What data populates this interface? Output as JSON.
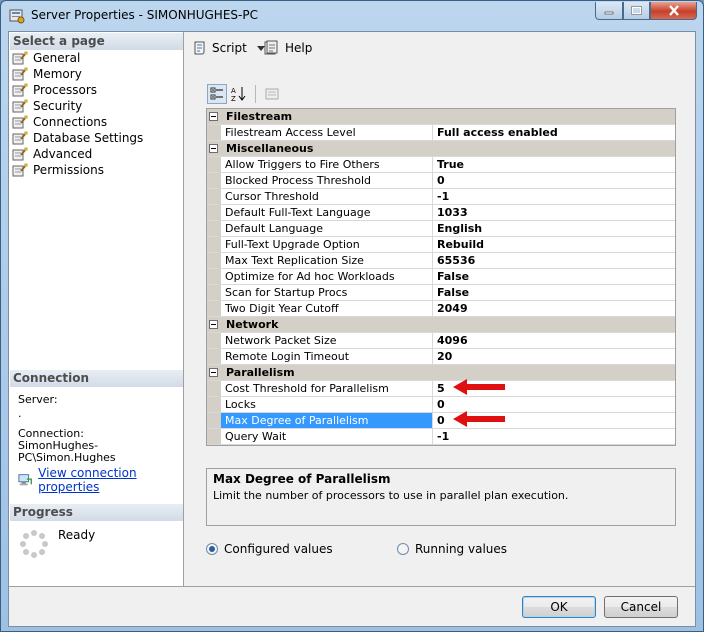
{
  "window": {
    "title": "Server Properties - SIMONHUGHES-PC"
  },
  "left_pane": {
    "select_page_header": "Select a page",
    "pages": [
      {
        "label": "General"
      },
      {
        "label": "Memory"
      },
      {
        "label": "Processors"
      },
      {
        "label": "Security"
      },
      {
        "label": "Connections"
      },
      {
        "label": "Database Settings"
      },
      {
        "label": "Advanced"
      },
      {
        "label": "Permissions"
      }
    ],
    "connection_header": "Connection",
    "server_label": "Server:",
    "server_value": ".",
    "connection_label": "Connection:",
    "connection_value": "SimonHughes-PC\\Simon.Hughes",
    "view_connection_link": "View connection properties",
    "progress_header": "Progress",
    "progress_status": "Ready"
  },
  "toolbar": {
    "script_label": "Script",
    "help_label": "Help"
  },
  "grid": {
    "rows": [
      {
        "type": "category",
        "label": "Filestream"
      },
      {
        "type": "prop",
        "name": "Filestream Access Level",
        "value": "Full access enabled"
      },
      {
        "type": "category",
        "label": "Miscellaneous"
      },
      {
        "type": "prop",
        "name": "Allow Triggers to Fire Others",
        "value": "True"
      },
      {
        "type": "prop",
        "name": "Blocked Process Threshold",
        "value": "0"
      },
      {
        "type": "prop",
        "name": "Cursor Threshold",
        "value": "-1"
      },
      {
        "type": "prop",
        "name": "Default Full-Text Language",
        "value": "1033"
      },
      {
        "type": "prop",
        "name": "Default Language",
        "value": "English"
      },
      {
        "type": "prop",
        "name": "Full-Text Upgrade Option",
        "value": "Rebuild"
      },
      {
        "type": "prop",
        "name": "Max Text Replication Size",
        "value": "65536"
      },
      {
        "type": "prop",
        "name": "Optimize for Ad hoc Workloads",
        "value": "False"
      },
      {
        "type": "prop",
        "name": "Scan for Startup Procs",
        "value": "False"
      },
      {
        "type": "prop",
        "name": "Two Digit Year Cutoff",
        "value": "2049"
      },
      {
        "type": "category",
        "label": "Network"
      },
      {
        "type": "prop",
        "name": "Network Packet Size",
        "value": "4096"
      },
      {
        "type": "prop",
        "name": "Remote Login Timeout",
        "value": "20"
      },
      {
        "type": "category",
        "label": "Parallelism"
      },
      {
        "type": "prop",
        "name": "Cost Threshold for Parallelism",
        "value": "5",
        "arrow": true
      },
      {
        "type": "prop",
        "name": "Locks",
        "value": "0"
      },
      {
        "type": "prop",
        "name": "Max Degree of Parallelism",
        "value": "0",
        "selected": true,
        "arrow": true
      },
      {
        "type": "prop",
        "name": "Query Wait",
        "value": "-1"
      }
    ]
  },
  "description": {
    "title": "Max Degree of Parallelism",
    "text": "Limit the number of processors to use in parallel plan execution."
  },
  "radios": {
    "configured_label": "Configured values",
    "running_label": "Running values",
    "selected": "configured"
  },
  "buttons": {
    "ok_label": "OK",
    "cancel_label": "Cancel"
  },
  "colors": {
    "arrow": "#e01010",
    "selection": "#3399ff",
    "link": "#0033cc"
  }
}
